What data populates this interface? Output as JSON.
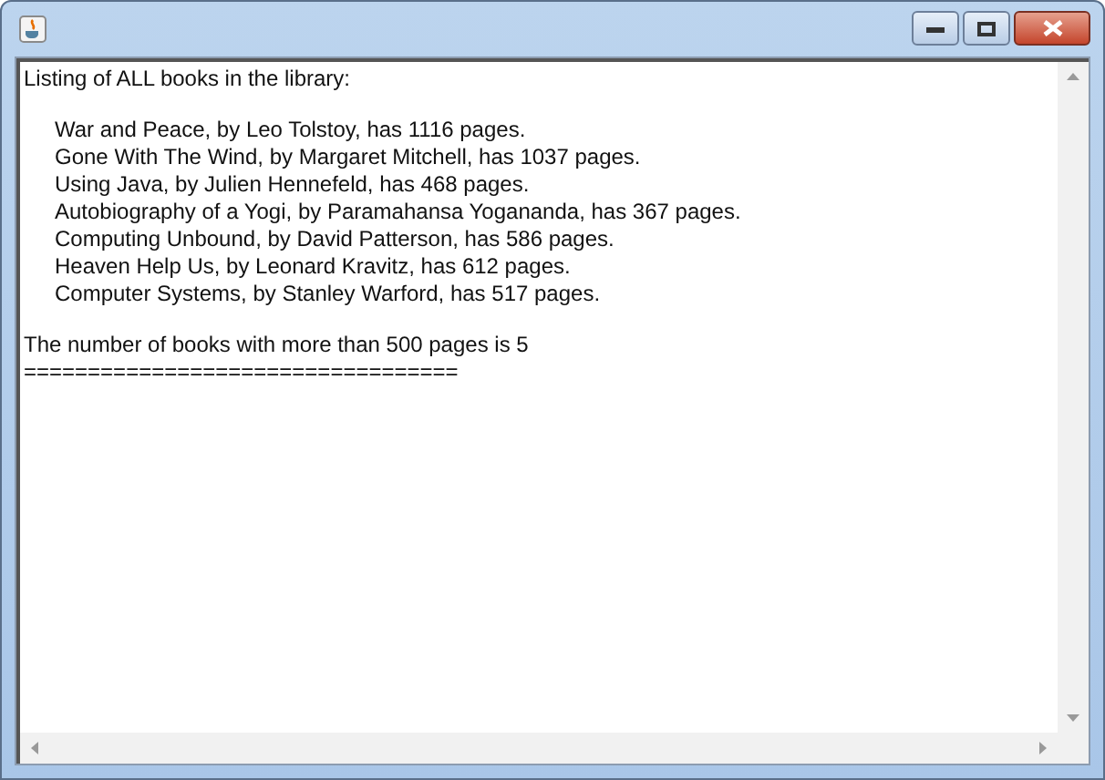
{
  "output": {
    "heading": "Listing of ALL books in the library:",
    "books": [
      "War and Peace, by Leo Tolstoy, has 1116 pages.",
      "Gone With The Wind, by Margaret Mitchell, has 1037 pages.",
      "Using Java, by Julien Hennefeld, has 468 pages.",
      "Autobiography of a Yogi, by Paramahansa Yogananda, has 367 pages.",
      "Computing Unbound, by David Patterson, has 586 pages.",
      "Heaven Help Us, by Leonard Kravitz, has 612 pages.",
      "Computer Systems, by Stanley Warford, has 517 pages."
    ],
    "summary": "The number of books with more than 500 pages is 5",
    "separator": "=================================="
  }
}
